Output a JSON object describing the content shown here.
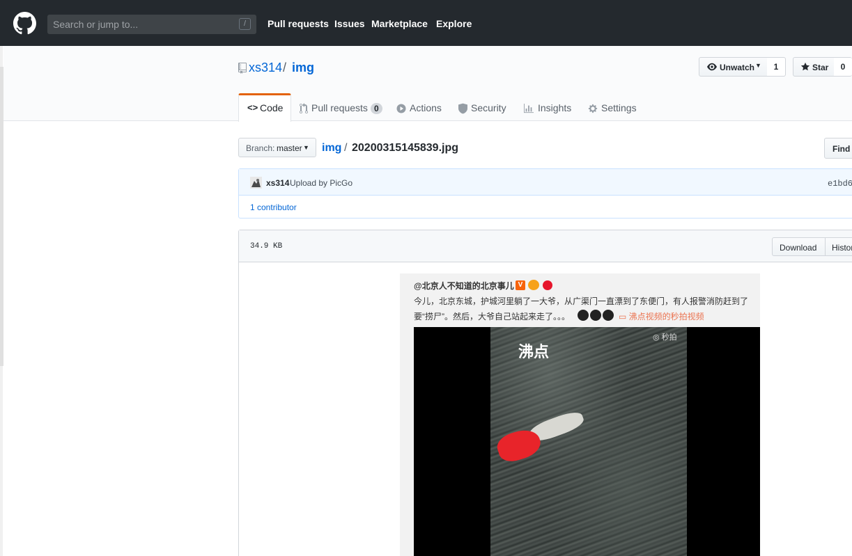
{
  "header": {
    "search_placeholder": "Search or jump to...",
    "search_key": "/",
    "nav": [
      "Pull requests",
      "Issues",
      "Marketplace",
      "Explore"
    ]
  },
  "repo": {
    "owner": "xs314",
    "separator": "/",
    "name": "img",
    "unwatch_label": "Unwatch",
    "watch_count": "1",
    "star_label": "Star",
    "star_count": "0"
  },
  "tabs": [
    {
      "label": "Code",
      "icon": "code-icon",
      "selected": true
    },
    {
      "label": "Pull requests",
      "icon": "git-pull-request-icon",
      "counter": "0"
    },
    {
      "label": "Actions",
      "icon": "play-icon"
    },
    {
      "label": "Security",
      "icon": "shield-icon"
    },
    {
      "label": "Insights",
      "icon": "graph-icon"
    },
    {
      "label": "Settings",
      "icon": "gear-icon"
    }
  ],
  "file_nav": {
    "branch_prefix": "Branch:",
    "branch": "master",
    "path_root": "img",
    "path_sep": "/",
    "filename": "20200315145839.jpg",
    "find_file_label": "Find f"
  },
  "commit": {
    "author": "xs314",
    "message": "Upload by PicGo",
    "sha": "e1bd6",
    "contributors": "1 contributor"
  },
  "file": {
    "size": "34.9 KB",
    "download_label": "Download",
    "history_label": "Histor"
  },
  "image_content": {
    "user": "@北京人不知道的北京事儿",
    "verified_badge": "V",
    "text_line1": "今儿，北京东城，护城河里躺了一大爷，从广渠门一直漂到了东便门，有人报警消防赶到了",
    "text_line2": "要“捞尸”。然后，大爷自己站起来走了。。。",
    "link_text": "沸点视频的秒拍视频",
    "video_logo": "沸点",
    "video_watermark": "秒拍"
  },
  "colors": {
    "header_bg": "#24292e",
    "link": "#0366d6",
    "tab_accent": "#e36209",
    "weibo_link": "#eb7350"
  }
}
